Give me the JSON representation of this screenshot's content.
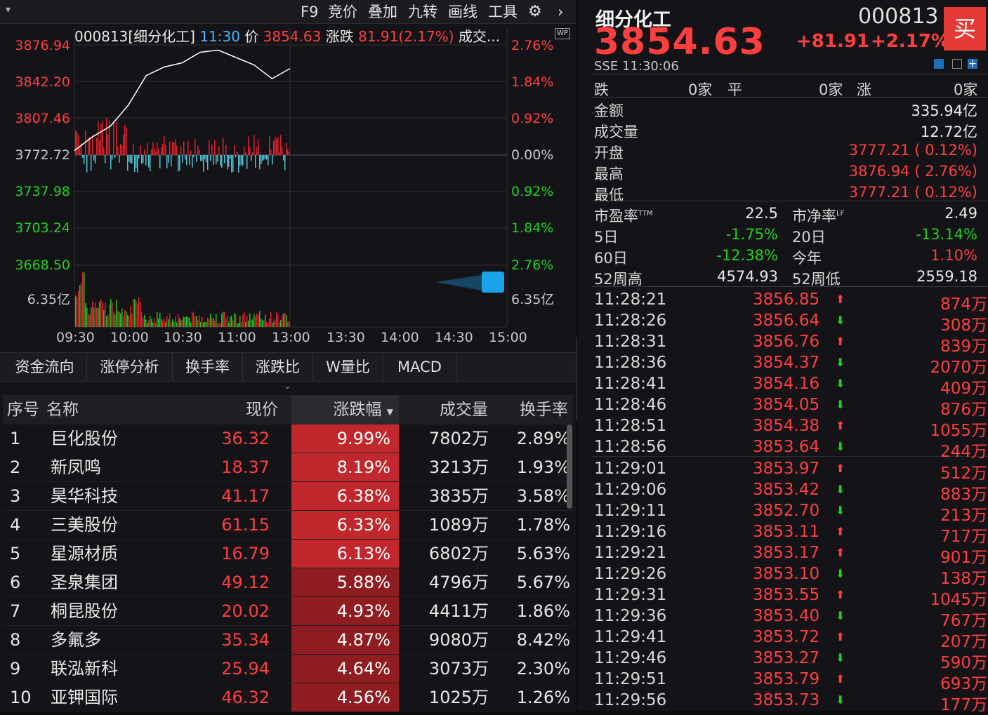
{
  "toolbar": {
    "items": [
      "F9",
      "竞价",
      "叠加",
      "九转",
      "画线",
      "工具"
    ]
  },
  "chart": {
    "code_name": "000813[细分化工]",
    "time": "11:30",
    "price_label": "价",
    "price": "3854.63",
    "chg_label": "涨跌",
    "chg": "81.91(2.17%)",
    "vol_label": "成交...",
    "y_left": [
      "3876.94",
      "3842.20",
      "3807.46",
      "3772.72",
      "3737.98",
      "3703.24",
      "3668.50"
    ],
    "y_right": [
      "2.76%",
      "1.84%",
      "0.92%",
      "0.00%",
      "0.92%",
      "1.84%",
      "2.76%"
    ],
    "vol_left": "6.35亿",
    "vol_right": "6.35亿",
    "time_axis": [
      "09:30",
      "10:00",
      "10:30",
      "11:00",
      "13:00",
      "13:30",
      "14:00",
      "14:30",
      "15:00"
    ],
    "badge": "WP"
  },
  "chart_data": {
    "type": "line",
    "x": [
      "09:30",
      "09:40",
      "09:50",
      "10:00",
      "10:10",
      "10:20",
      "10:30",
      "10:40",
      "10:50",
      "11:00",
      "11:10",
      "11:20",
      "11:30"
    ],
    "values": [
      3777,
      3790,
      3800,
      3820,
      3848,
      3856,
      3860,
      3870,
      3872,
      3865,
      3858,
      3845,
      3854.63
    ],
    "ylim": [
      3668.5,
      3876.94
    ]
  },
  "tabs": [
    "资金流向",
    "涨停分析",
    "换手率",
    "涨跌比",
    "W量比",
    "MACD"
  ],
  "table": {
    "headers": [
      "序号",
      "名称",
      "现价",
      "涨跌幅",
      "成交量",
      "换手率"
    ],
    "rows": [
      {
        "no": "1",
        "name": "巨化股份",
        "price": "36.32",
        "pct": "9.99%",
        "vol": "7802万",
        "turn": "2.89%",
        "c": "#c0282d"
      },
      {
        "no": "2",
        "name": "新凤鸣",
        "price": "18.37",
        "pct": "8.19%",
        "vol": "3213万",
        "turn": "1.93%",
        "c": "#c0282d"
      },
      {
        "no": "3",
        "name": "昊华科技",
        "price": "41.17",
        "pct": "6.38%",
        "vol": "3835万",
        "turn": "3.58%",
        "c": "#c0282d"
      },
      {
        "no": "4",
        "name": "三美股份",
        "price": "61.15",
        "pct": "6.33%",
        "vol": "1089万",
        "turn": "1.78%",
        "c": "#c0282d"
      },
      {
        "no": "5",
        "name": "星源材质",
        "price": "16.79",
        "pct": "6.13%",
        "vol": "6802万",
        "turn": "5.63%",
        "c": "#c0282d"
      },
      {
        "no": "6",
        "name": "圣泉集团",
        "price": "49.12",
        "pct": "5.88%",
        "vol": "4796万",
        "turn": "5.67%",
        "c": "#8f1c20"
      },
      {
        "no": "7",
        "name": "桐昆股份",
        "price": "20.02",
        "pct": "4.93%",
        "vol": "4411万",
        "turn": "1.86%",
        "c": "#8f1c20"
      },
      {
        "no": "8",
        "name": "多氟多",
        "price": "35.34",
        "pct": "4.87%",
        "vol": "9080万",
        "turn": "8.42%",
        "c": "#8f1c20"
      },
      {
        "no": "9",
        "name": "联泓新科",
        "price": "25.94",
        "pct": "4.64%",
        "vol": "3073万",
        "turn": "2.30%",
        "c": "#8f1c20"
      },
      {
        "no": "10",
        "name": "亚钾国际",
        "price": "46.32",
        "pct": "4.56%",
        "vol": "1025万",
        "turn": "1.26%",
        "c": "#8f1c20"
      }
    ]
  },
  "quote": {
    "name": "细分化工",
    "code": "000813",
    "price": "3854.63",
    "chg": "+81.91",
    "pct": "+2.17%",
    "buy": "买",
    "exchange_time": "SSE  11:30:06",
    "breadth": {
      "down_label": "跌",
      "down": "0家",
      "flat_label": "平",
      "flat": "0家",
      "up_label": "涨",
      "up": "0家"
    },
    "stats": [
      {
        "k": "金额",
        "v": "335.94亿",
        "c": "white"
      },
      {
        "k": "成交量",
        "v": "12.72亿",
        "c": "white"
      },
      {
        "k": "开盘",
        "v": "3777.21 ( 0.12%)",
        "c": "red"
      },
      {
        "k": "最高",
        "v": "3876.94 ( 2.76%)",
        "c": "red"
      },
      {
        "k": "最低",
        "v": "3777.21 ( 0.12%)",
        "c": "red"
      }
    ],
    "pe_label": "市盈率",
    "pe_sup": "TTM",
    "pe": "22.5",
    "pb_label": "市净率",
    "pb_sup": "LF",
    "pb": "2.49",
    "d5_label": "5日",
    "d5": "-1.75%",
    "d20_label": "20日",
    "d20": "-13.14%",
    "d60_label": "60日",
    "d60": "-12.38%",
    "ytd_label": "今年",
    "ytd": "1.10%",
    "hi52_label": "52周高",
    "hi52": "4574.93",
    "lo52_label": "52周低",
    "lo52": "2559.18"
  },
  "ticks": [
    {
      "t": "11:28:21",
      "p": "3856.85",
      "d": "up",
      "v": "874万"
    },
    {
      "t": "11:28:26",
      "p": "3856.64",
      "d": "down",
      "v": "308万"
    },
    {
      "t": "11:28:31",
      "p": "3856.76",
      "d": "up",
      "v": "839万"
    },
    {
      "t": "11:28:36",
      "p": "3854.37",
      "d": "down",
      "v": "2070万"
    },
    {
      "t": "11:28:41",
      "p": "3854.16",
      "d": "down",
      "v": "409万"
    },
    {
      "t": "11:28:46",
      "p": "3854.05",
      "d": "down",
      "v": "876万"
    },
    {
      "t": "11:28:51",
      "p": "3854.38",
      "d": "up",
      "v": "1055万"
    },
    {
      "t": "11:28:56",
      "p": "3853.64",
      "d": "down",
      "v": "244万"
    },
    {
      "t": "11:29:01",
      "p": "3853.97",
      "d": "up",
      "v": "512万"
    },
    {
      "t": "11:29:06",
      "p": "3853.42",
      "d": "down",
      "v": "883万"
    },
    {
      "t": "11:29:11",
      "p": "3852.70",
      "d": "down",
      "v": "213万"
    },
    {
      "t": "11:29:16",
      "p": "3853.11",
      "d": "up",
      "v": "717万"
    },
    {
      "t": "11:29:21",
      "p": "3853.17",
      "d": "up",
      "v": "901万"
    },
    {
      "t": "11:29:26",
      "p": "3853.10",
      "d": "down",
      "v": "138万"
    },
    {
      "t": "11:29:31",
      "p": "3853.55",
      "d": "up",
      "v": "1045万"
    },
    {
      "t": "11:29:36",
      "p": "3853.40",
      "d": "down",
      "v": "767万"
    },
    {
      "t": "11:29:41",
      "p": "3853.72",
      "d": "up",
      "v": "207万"
    },
    {
      "t": "11:29:46",
      "p": "3853.27",
      "d": "down",
      "v": "590万"
    },
    {
      "t": "11:29:51",
      "p": "3853.79",
      "d": "up",
      "v": "693万"
    },
    {
      "t": "11:29:56",
      "p": "3853.73",
      "d": "down",
      "v": "177万"
    }
  ]
}
